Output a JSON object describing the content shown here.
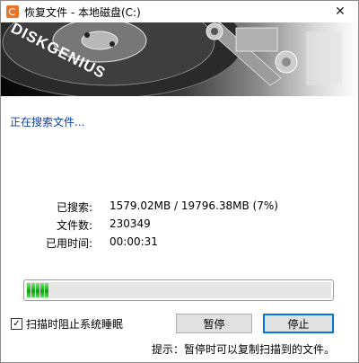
{
  "window": {
    "title": "恢复文件 - 本地磁盘(C:)",
    "close_glyph": "✕"
  },
  "banner": {
    "brand_text": "DISKGENIUS"
  },
  "status": {
    "heading": "正在搜索文件..."
  },
  "stats": [
    {
      "label": "已搜索:",
      "value": "1579.02MB / 19796.38MB (7%)"
    },
    {
      "label": "文件数:",
      "value": "230349"
    },
    {
      "label": "已用时间:",
      "value": "00:00:31"
    }
  ],
  "progress": {
    "percent": 7,
    "color": "#22b522"
  },
  "options": {
    "sleep_checkbox_label": "扫描时阻止系统睡眠",
    "sleep_checkbox_checked": true,
    "check_glyph": "✓"
  },
  "buttons": {
    "pause": "暂停",
    "stop": "停止"
  },
  "hint": "提示：暂停时可以复制扫描到的文件。",
  "colors": {
    "heading": "#0a3fa8",
    "focus_border": "#0078d7",
    "app_icon": "#e8742a"
  },
  "icons": [
    "diskgenius-app-icon",
    "close-icon",
    "hard-disk-banner-image"
  ]
}
